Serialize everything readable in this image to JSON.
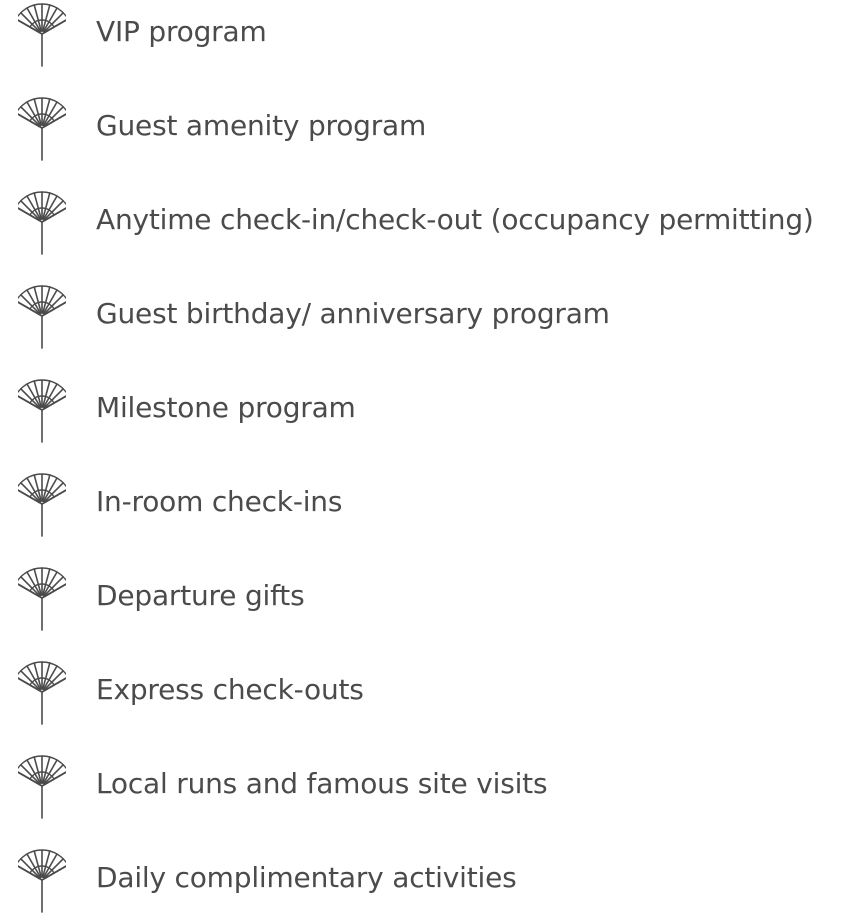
{
  "icon": "ginkgo-leaf-icon",
  "accent_color": "#4b4b4b",
  "items": [
    {
      "label": "VIP program"
    },
    {
      "label": "Guest amenity program"
    },
    {
      "label": "Anytime check-in/check-out (occupancy permitting)"
    },
    {
      "label": "Guest birthday/ anniversary program"
    },
    {
      "label": "Milestone program"
    },
    {
      "label": "In-room check-ins"
    },
    {
      "label": "Departure gifts"
    },
    {
      "label": "Express check-outs"
    },
    {
      "label": "Local runs and famous site visits"
    },
    {
      "label": "Daily complimentary activities"
    }
  ]
}
